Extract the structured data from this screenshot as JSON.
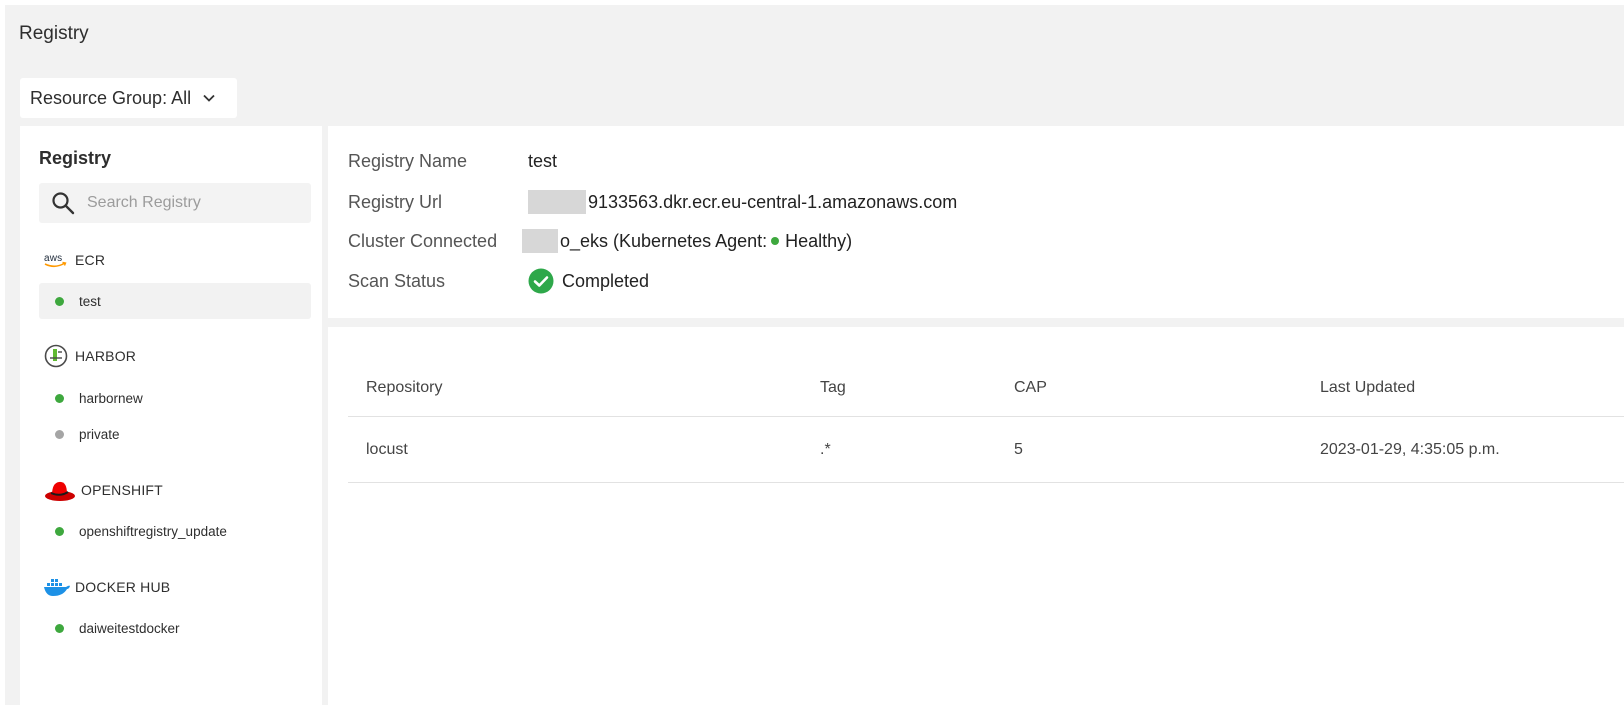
{
  "page": {
    "title": "Registry"
  },
  "resource_group": {
    "label": "Resource Group: All"
  },
  "sidebar": {
    "title": "Registry",
    "search_placeholder": "Search Registry",
    "groups": [
      {
        "name": "ECR",
        "icon": "aws-icon",
        "items": [
          {
            "label": "test",
            "status": "healthy"
          }
        ]
      },
      {
        "name": "HARBOR",
        "icon": "harbor-icon",
        "items": [
          {
            "label": "harbornew",
            "status": "healthy"
          },
          {
            "label": "private",
            "status": "unknown"
          }
        ]
      },
      {
        "name": "OPENSHIFT",
        "icon": "openshift-icon",
        "items": [
          {
            "label": "openshiftregistry_update",
            "status": "healthy"
          }
        ]
      },
      {
        "name": "DOCKER HUB",
        "icon": "docker-icon",
        "items": [
          {
            "label": "daiweitestdocker",
            "status": "healthy"
          }
        ]
      }
    ]
  },
  "details": {
    "name_label": "Registry Name",
    "name_value": "test",
    "url_label": "Registry Url",
    "url_value": "9133563.dkr.ecr.eu-central-1.amazonaws.com",
    "cluster_label": "Cluster Connected",
    "cluster_value": "o_eks (Kubernetes Agent:",
    "cluster_status": "Healthy)",
    "scan_label": "Scan Status",
    "scan_value": "Completed"
  },
  "table": {
    "headers": [
      "Repository",
      "Tag",
      "CAP",
      "Last Updated"
    ],
    "rows": [
      [
        "locust",
        ".*",
        "5",
        "2023-01-29, 4:35:05 p.m."
      ]
    ]
  },
  "colors": {
    "healthy": "#3ea83e",
    "unknown": "#a5a5a5",
    "panel": "#ffffff",
    "background": "#f2f2f2"
  }
}
